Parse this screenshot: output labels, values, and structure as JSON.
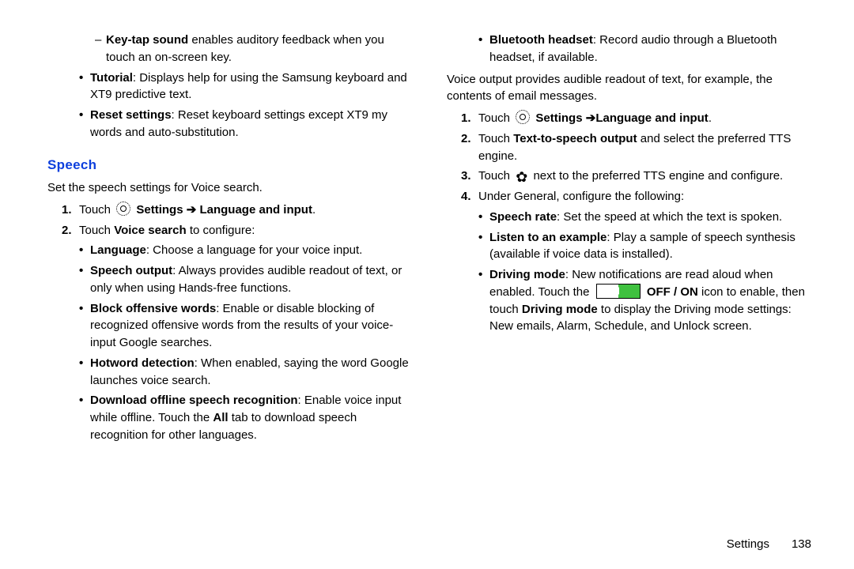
{
  "left": {
    "dash1_b": "Key-tap sound",
    "dash1_r": " enables auditory feedback when you touch an on-screen key.",
    "b_tut_b": "Tutorial",
    "b_tut_r": ": Displays help for using the Samsung keyboard and XT9 predictive text.",
    "b_rst_b": "Reset settings",
    "b_rst_r": ": Reset keyboard settings except XT9 my words and auto-substitution.",
    "heading": "Speech",
    "intro": "Set the speech settings for Voice search.",
    "s1_pre": "Touch ",
    "s1_b1": "Settings",
    "s1_arrow": " ➔ ",
    "s1_b2": " Language and input",
    "s1_end": ".",
    "s2_pre": "Touch ",
    "s2_b": "Voice search",
    "s2_end": " to configure:",
    "vs_lang_b": "Language",
    "vs_lang_r": ": Choose a language for your voice input.",
    "vs_so_b": "Speech output",
    "vs_so_r": ": Always provides audible readout of text, or only when using Hands-free functions.",
    "vs_bo_b": "Block offensive words",
    "vs_bo_r": ": Enable or disable blocking of recognized offensive words from the results of your voice-input Google searches.",
    "vs_hw_b": "Hotword detection",
    "vs_hw_r": ": When enabled, saying the word Google launches voice search.",
    "vs_dl_b": "Download offline speech recognition",
    "vs_dl_r1": ": Enable voice input while offline. Touch the ",
    "vs_dl_b2": "All",
    "vs_dl_r2": " tab to download speech recognition for other languages."
  },
  "right": {
    "bt_b": "Bluetooth headset",
    "bt_r": ": Record audio through a Bluetooth headset, if available.",
    "vo_para": "Voice output provides audible readout of text, for example, the contents of email messages.",
    "r1_pre": "Touch ",
    "r1_b1": "Settings",
    "r1_arrow": " ➔",
    "r1_b2": "Language and input",
    "r1_end": ".",
    "r2_pre": "Touch ",
    "r2_b": "Text-to-speech output",
    "r2_r": " and select the preferred TTS engine.",
    "r3_pre": "Touch ",
    "r3_r": " next to the preferred TTS engine and configure.",
    "r4": "Under General, configure the following:",
    "g_sr_b": "Speech rate",
    "g_sr_r": ": Set the speed at which the text is spoken.",
    "g_ls_b": "Listen to an example",
    "g_ls_r": ": Play a sample of speech synthesis (available if voice data is installed).",
    "g_dm_b": "Driving mode",
    "g_dm_r1": ": New notifications are read aloud when enabled. Touch the ",
    "g_dm_b2": "OFF / ON",
    "g_dm_r2": " icon to enable, then touch ",
    "g_dm_b3": "Driving mode",
    "g_dm_r3": " to display the Driving mode settings: New emails, Alarm, Schedule, and Unlock screen."
  },
  "footer": {
    "section": "Settings",
    "page": "138"
  },
  "marks": {
    "bullet": "•",
    "dash": "–",
    "n1": "1.",
    "n2": "2.",
    "n3": "3.",
    "n4": "4."
  }
}
